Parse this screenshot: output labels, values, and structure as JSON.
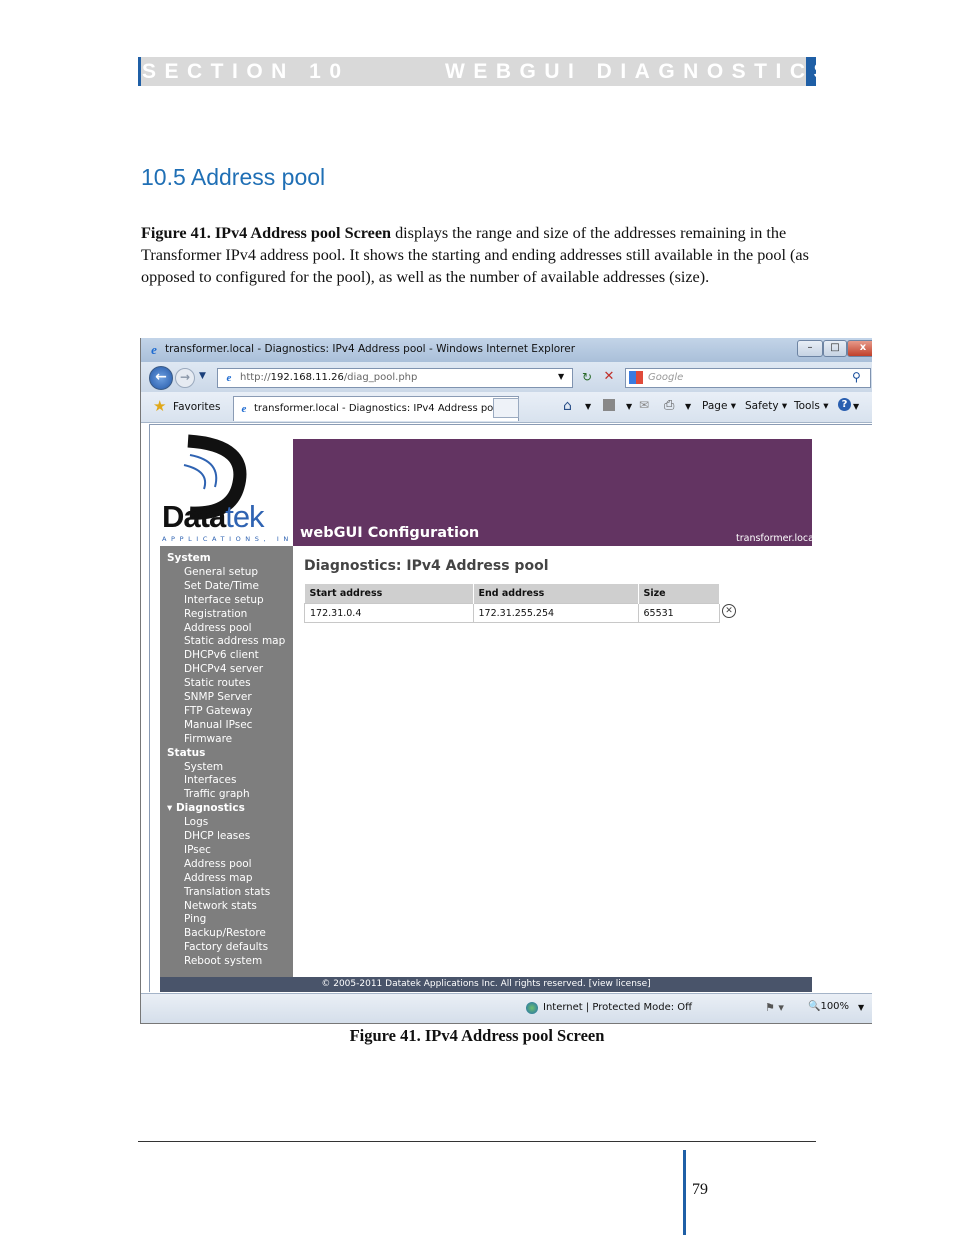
{
  "header": {
    "section": "SECTION 10",
    "title": "WEBGUI DIAGNOSTICS"
  },
  "heading": "10.5  Address pool",
  "paragraph": {
    "bold": "Figure 41. IPv4 Address pool Screen",
    "rest": " displays the range and size of the addresses remaining in the Transformer IPv4 address pool. It shows the starting and ending addresses still available in the pool (as opposed to configured for the pool), as well as the number of available addresses (size)."
  },
  "browser": {
    "window_title": "transformer.local - Diagnostics: IPv4 Address pool - Windows Internet Explorer",
    "url_prefix": "http://",
    "url_host": "192.168.11.26",
    "url_path": "/diag_pool.php",
    "search_placeholder": "Google",
    "favorites": "Favorites",
    "tab_title": "transformer.local - Diagnostics: IPv4 Address pool",
    "commands": {
      "page": "Page",
      "safety": "Safety",
      "tools": "Tools"
    },
    "status_zone": "Internet | Protected Mode: Off",
    "zoom": "100%",
    "winbtn": {
      "min": "–",
      "max": "□",
      "close": "x"
    }
  },
  "webgui": {
    "logo": {
      "data": "Data",
      "tek": "tek",
      "tagline": "APPLICATIONS, INC"
    },
    "title": "webGUI Configuration",
    "host": "transformer.local",
    "sidebar": {
      "system_header": "System",
      "system": [
        "General setup",
        "Set Date/Time",
        "Interface setup",
        "Registration",
        "Address pool",
        "Static address map",
        "DHCPv6 client",
        "DHCPv4 server",
        "Static routes",
        "SNMP Server",
        "FTP Gateway",
        "Manual IPsec",
        "Firmware"
      ],
      "status_header": "Status",
      "status": [
        "System",
        "Interfaces",
        "Traffic graph"
      ],
      "diagnostics_header": "Diagnostics",
      "diagnostics": [
        "Logs",
        "DHCP leases",
        "IPsec",
        "Address pool",
        "Address map",
        "Translation stats",
        "Network stats",
        "Ping",
        "Backup/Restore",
        "Factory defaults",
        "Reboot system"
      ]
    },
    "page_title": "Diagnostics: IPv4 Address pool",
    "table": {
      "headers": [
        "Start address",
        "End address",
        "Size"
      ],
      "rows": [
        [
          "172.31.0.4",
          "172.31.255.254",
          "65531"
        ]
      ]
    },
    "copyright": "© 2005-2011 Datatek Applications Inc. All rights reserved.  [view license]"
  },
  "caption": "Figure 41. IPv4 Address pool Screen",
  "page_number": "79"
}
